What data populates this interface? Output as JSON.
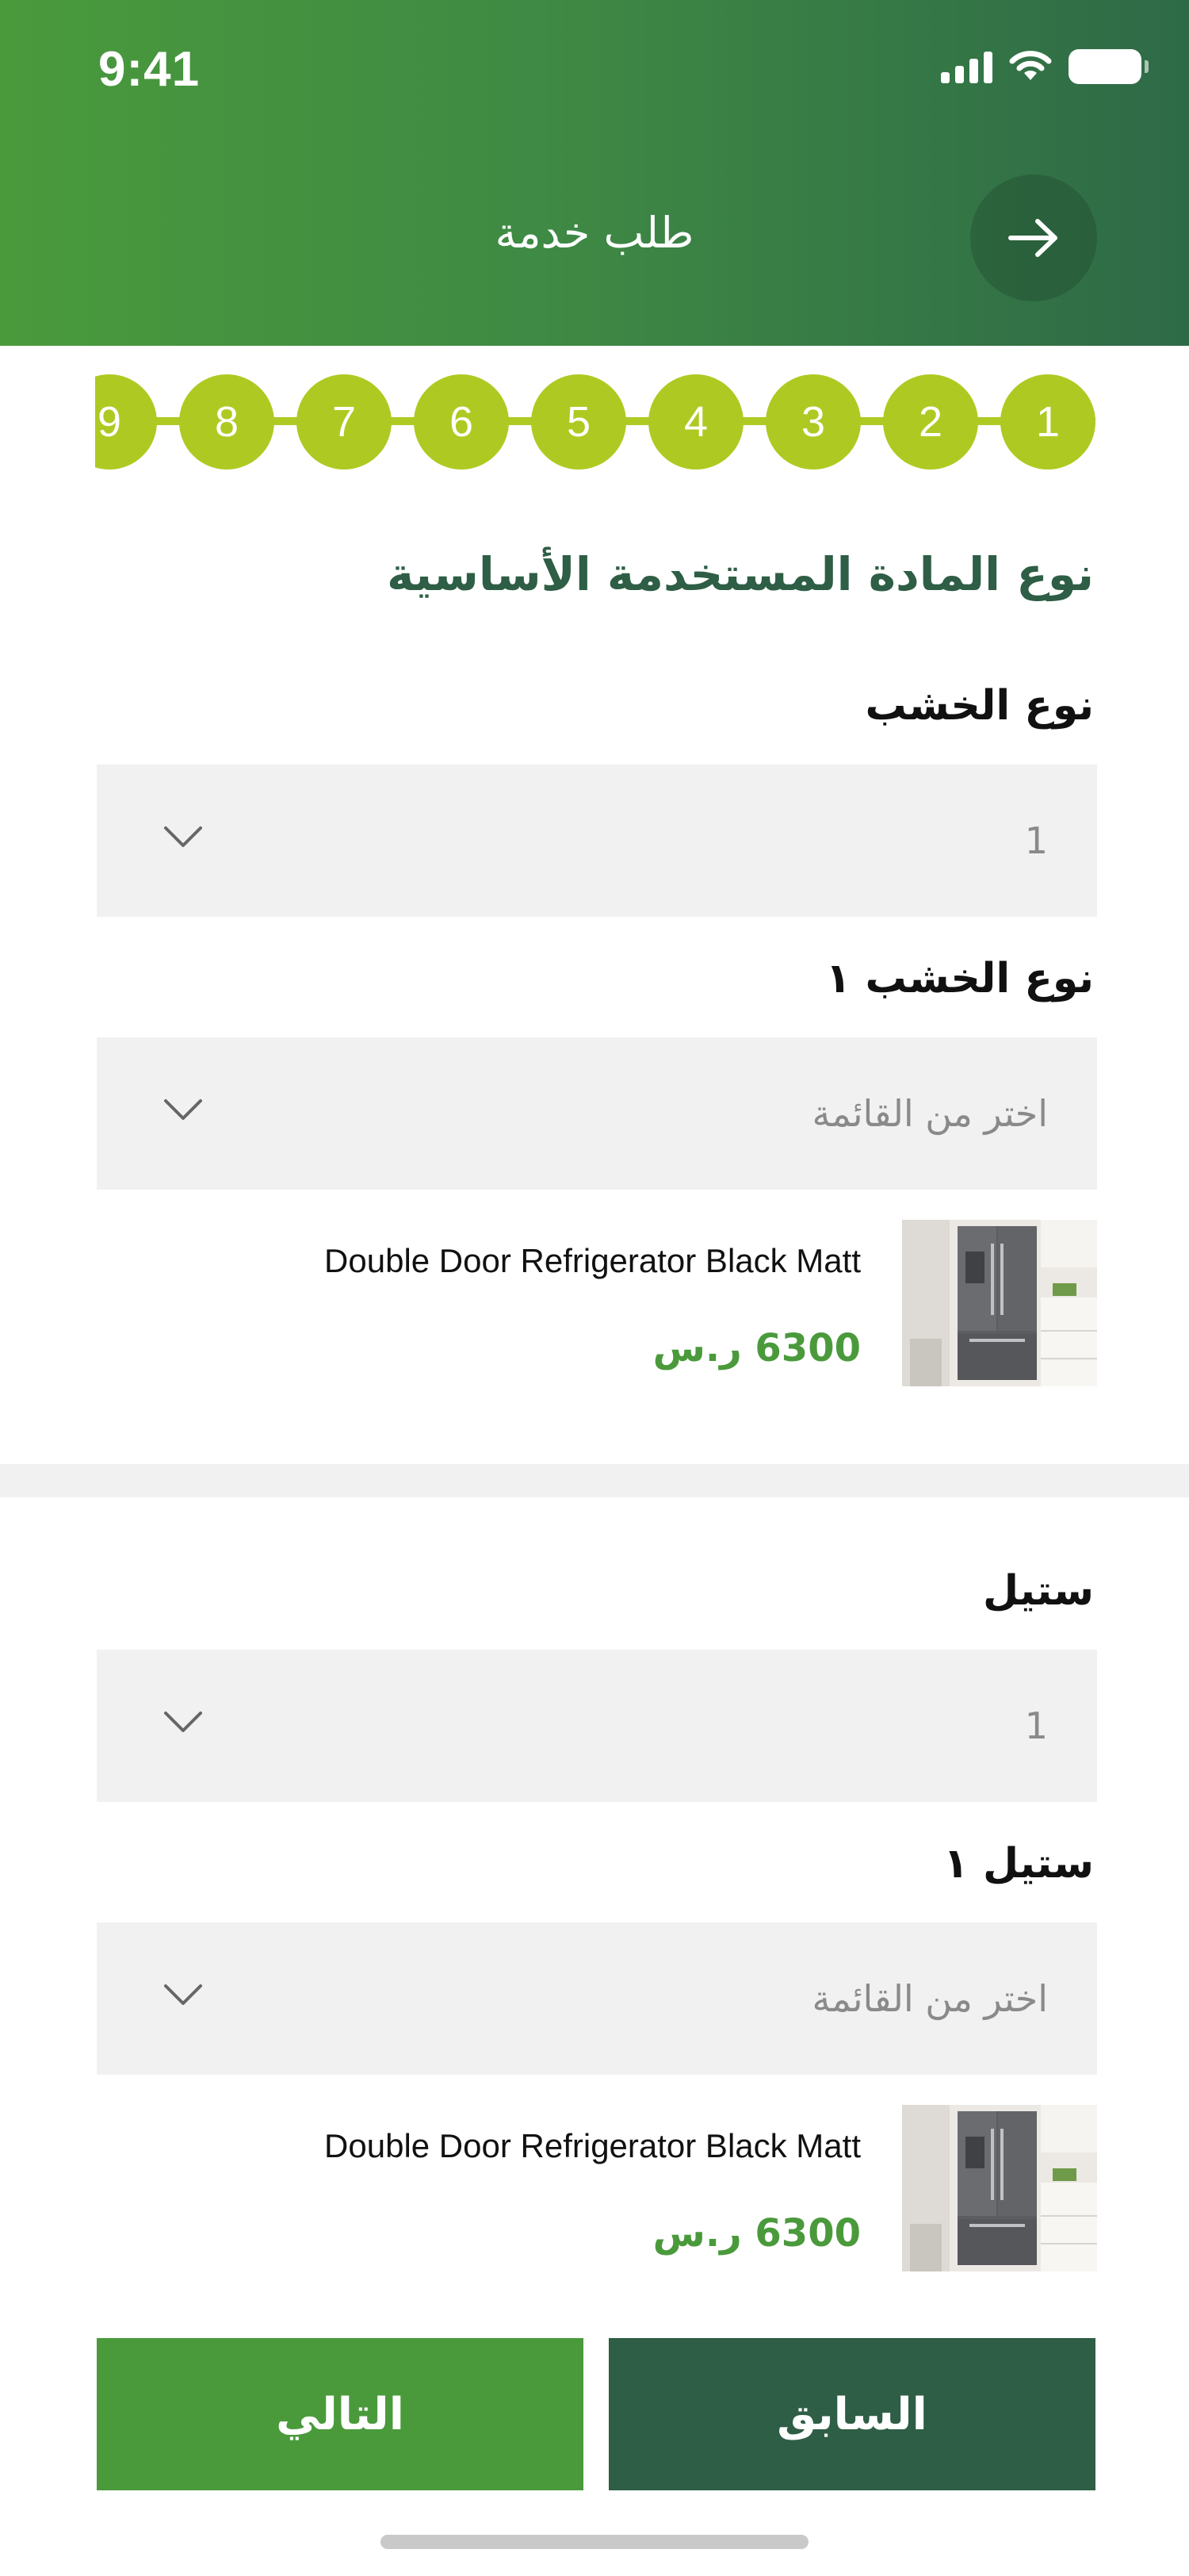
{
  "status_bar": {
    "time": "9:41"
  },
  "header": {
    "title": "طلب خدمة"
  },
  "stepper": {
    "steps": [
      "1",
      "2",
      "3",
      "4",
      "5",
      "6",
      "7",
      "8",
      "9"
    ]
  },
  "section": {
    "title": "نوع المادة المستخدمة الأساسية"
  },
  "groups": [
    {
      "field1_label": "نوع الخشب",
      "field1_value": "1",
      "field2_label": "نوع الخشب ١",
      "field2_placeholder": "اختر من القائمة",
      "product": {
        "name": "Double Door Refrigerator Black Matt",
        "price": "6300 ر.س"
      }
    },
    {
      "field1_label": "ستيل",
      "field1_value": "1",
      "field2_label": "ستيل ١",
      "field2_placeholder": "اختر من القائمة",
      "product": {
        "name": "Double Door Refrigerator Black Matt",
        "price": "6300 ر.س"
      }
    }
  ],
  "footer": {
    "next_label": "التالي",
    "prev_label": "السابق"
  },
  "colors": {
    "primary_green": "#4a9a3c",
    "dark_green": "#2e5e45",
    "step_lime": "#aeca22",
    "field_bg": "#f1f1f1"
  }
}
